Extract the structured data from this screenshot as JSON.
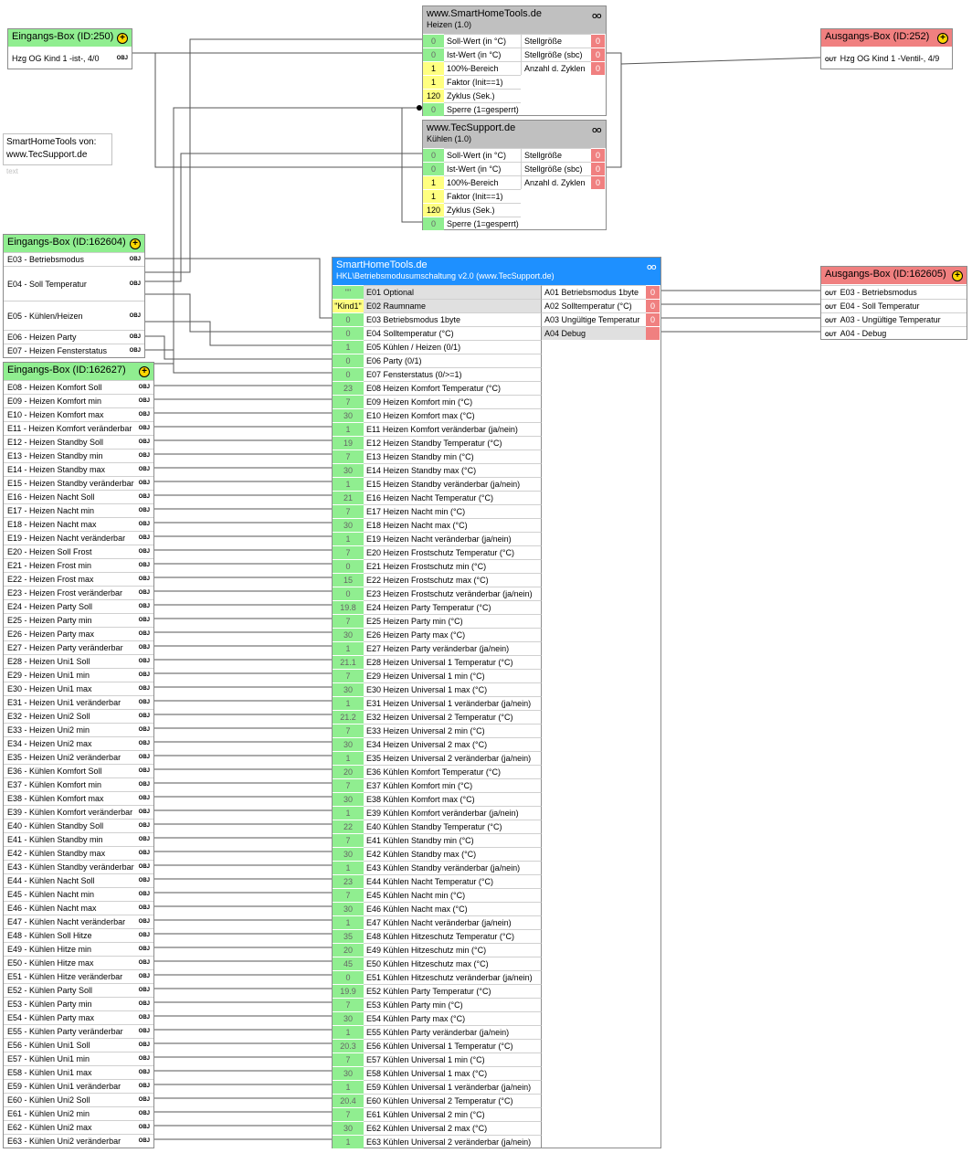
{
  "in250": {
    "title": "Eingangs-Box (ID:250)",
    "rows": [
      "Hzg OG Kind 1 -ist-, 4/0"
    ],
    "tag": "OBJ"
  },
  "out252": {
    "title": "Ausgangs-Box (ID:252)",
    "rows": [
      "Hzg OG Kind 1 -Ventil-, 4/9"
    ],
    "tag": "OUT"
  },
  "heizen": {
    "title": "www.SmartHomeTools.de",
    "subtitle": "Heizen (1.0)",
    "oo": "OO",
    "inputs": [
      {
        "v": "0",
        "l": "Soll-Wert (in °C)"
      },
      {
        "v": "0",
        "l": "Ist-Wert (in °C)"
      },
      {
        "v": "1",
        "l": "100%-Bereich"
      },
      {
        "v": "1",
        "l": "Faktor (Init==1)"
      },
      {
        "v": "120",
        "l": "Zyklus (Sek.)"
      },
      {
        "v": "0",
        "l": "Sperre (1=gesperrt)"
      }
    ],
    "outputs": [
      {
        "l": "Stellgröße",
        "v": "0"
      },
      {
        "l": "Stellgröße (sbc)",
        "v": "0"
      },
      {
        "l": "Anzahl d. Zyklen",
        "v": "0"
      }
    ]
  },
  "kuehlen": {
    "title": "www.TecSupport.de",
    "subtitle": "Kühlen (1.0)",
    "oo": "OO",
    "inputs": [
      {
        "v": "0",
        "l": "Soll-Wert (in °C)"
      },
      {
        "v": "0",
        "l": "Ist-Wert (in °C)"
      },
      {
        "v": "1",
        "l": "100%-Bereich"
      },
      {
        "v": "1",
        "l": "Faktor (Init==1)"
      },
      {
        "v": "120",
        "l": "Zyklus (Sek.)"
      },
      {
        "v": "0",
        "l": "Sperre (1=gesperrt)"
      }
    ],
    "outputs": [
      {
        "l": "Stellgröße",
        "v": "0"
      },
      {
        "l": "Stellgröße (sbc)",
        "v": "0"
      },
      {
        "l": "Anzahl d. Zyklen",
        "v": "0"
      }
    ]
  },
  "note": {
    "line1": "SmartHomeTools von:",
    "line2": "www.TecSupport.de",
    "tag": "text"
  },
  "in162604": {
    "title": "Eingangs-Box (ID:162604)",
    "tag": "OBJ",
    "rows": [
      "E03 - Betriebsmodus",
      "E04 - Soll Temperatur",
      "E05 - Kühlen/Heizen",
      "E06 - Heizen Party",
      "E07 - Heizen Fensterstatus"
    ]
  },
  "in162627": {
    "title": "Eingangs-Box (ID:162627)",
    "tag": "OBJ",
    "rows": [
      "E08 - Heizen Komfort Soll",
      "E09 - Heizen Komfort min",
      "E10 - Heizen Komfort max",
      "E11 - Heizen Komfort veränderbar",
      "E12 - Heizen Standby Soll",
      "E13 - Heizen Standby min",
      "E14 - Heizen Standby max",
      "E15 - Heizen Standby veränderbar",
      "E16 - Heizen Nacht Soll",
      "E17 - Heizen Nacht min",
      "E18 - Heizen Nacht max",
      "E19 - Heizen Nacht veränderbar",
      "E20 - Heizen Soll Frost",
      "E21 - Heizen Frost min",
      "E22 - Heizen Frost max",
      "E23 - Heizen Frost veränderbar",
      "E24 - Heizen Party Soll",
      "E25 - Heizen Party min",
      "E26 - Heizen Party max",
      "E27 - Heizen Party veränderbar",
      "E28 - Heizen Uni1 Soll",
      "E29 - Heizen Uni1 min",
      "E30 - Heizen Uni1 max",
      "E31 - Heizen Uni1 veränderbar",
      "E32 - Heizen Uni2 Soll",
      "E33 - Heizen Uni2 min",
      "E34 - Heizen Uni2 max",
      "E35 - Heizen Uni2 veränderbar",
      "E36 - Kühlen Komfort Soll",
      "E37 - Kühlen Komfort min",
      "E38 - Kühlen Komfort max",
      "E39 - Kühlen Komfort veränderbar",
      "E40 - Kühlen Standby Soll",
      "E41 - Kühlen Standby min",
      "E42 - Kühlen Standby max",
      "E43 - Kühlen Standby veränderbar",
      "E44 - Kühlen Nacht Soll",
      "E45 - Kühlen Nacht min",
      "E46 - Kühlen Nacht max",
      "E47 - Kühlen Nacht veränderbar",
      "E48 - Kühlen Soll Hitze",
      "E49 - Kühlen Hitze min",
      "E50 - Kühlen Hitze max",
      "E51 - Kühlen Hitze veränderbar",
      "E52 - Kühlen Party Soll",
      "E53 - Kühlen Party min",
      "E54 - Kühlen Party max",
      "E55 - Kühlen Party veränderbar",
      "E56 - Kühlen Uni1 Soll",
      "E57 - Kühlen Uni1 min",
      "E58 - Kühlen Uni1 max",
      "E59 - Kühlen Uni1 veränderbar",
      "E60 - Kühlen Uni2 Soll",
      "E61 - Kühlen Uni2 min",
      "E62 - Kühlen Uni2 max",
      "E63 - Kühlen Uni2 veränderbar"
    ]
  },
  "out162605": {
    "title": "Ausgangs-Box (ID:162605)",
    "tag": "OUT",
    "rows": [
      "E03 - Betriebsmodus",
      "E04 - Soll Temperatur",
      "A03 - Ungültige Temperatur",
      "A04 - Debug"
    ]
  },
  "main": {
    "title": "SmartHomeTools.de",
    "subtitle": "HKL\\Betriebsmodusumschaltung v2.0 (www.TecSupport.de)",
    "oo": "OO",
    "outputs": [
      {
        "l": "A01 Betriebsmodus 1byte",
        "v": "0"
      },
      {
        "l": "A02 Solltemperatur (°C)",
        "v": "0"
      },
      {
        "l": "A03 Ungültige Temperatur",
        "v": "0"
      },
      {
        "l": "A04 Debug",
        "v": ""
      }
    ],
    "inputs": [
      {
        "v": "\"\"",
        "l": "E01 Optional",
        "gray": true
      },
      {
        "v": "\"Kind1\"",
        "l": "E02 Raumname",
        "gray": true,
        "y": true
      },
      {
        "v": "0",
        "l": "E03 Betriebsmodus 1byte"
      },
      {
        "v": "0",
        "l": "E04 Solltemperatur (°C)"
      },
      {
        "v": "1",
        "l": "E05 Kühlen / Heizen (0/1)"
      },
      {
        "v": "0",
        "l": "E06 Party (0/1)"
      },
      {
        "v": "0",
        "l": "E07 Fensterstatus (0/>=1)"
      },
      {
        "v": "23",
        "l": "E08 Heizen Komfort Temperatur (°C)"
      },
      {
        "v": "7",
        "l": "E09 Heizen Komfort min (°C)"
      },
      {
        "v": "30",
        "l": "E10 Heizen Komfort max (°C)"
      },
      {
        "v": "1",
        "l": "E11 Heizen Komfort veränderbar (ja/nein)"
      },
      {
        "v": "19",
        "l": "E12 Heizen Standby Temperatur (°C)"
      },
      {
        "v": "7",
        "l": "E13 Heizen Standby min (°C)"
      },
      {
        "v": "30",
        "l": "E14 Heizen Standby max (°C)"
      },
      {
        "v": "1",
        "l": "E15 Heizen Standby veränderbar (ja/nein)"
      },
      {
        "v": "21",
        "l": "E16 Heizen Nacht Temperatur (°C)"
      },
      {
        "v": "7",
        "l": "E17 Heizen Nacht min (°C)"
      },
      {
        "v": "30",
        "l": "E18 Heizen Nacht max (°C)"
      },
      {
        "v": "1",
        "l": "E19 Heizen Nacht veränderbar (ja/nein)"
      },
      {
        "v": "7",
        "l": "E20 Heizen Frostschutz Temperatur (°C)"
      },
      {
        "v": "0",
        "l": "E21 Heizen Frostschutz min (°C)"
      },
      {
        "v": "15",
        "l": "E22 Heizen Frostschutz max (°C)"
      },
      {
        "v": "0",
        "l": "E23 Heizen Frostschutz veränderbar (ja/nein)"
      },
      {
        "v": "19.8",
        "l": "E24 Heizen Party Temperatur (°C)"
      },
      {
        "v": "7",
        "l": "E25 Heizen Party min (°C)"
      },
      {
        "v": "30",
        "l": "E26 Heizen Party max (°C)"
      },
      {
        "v": "1",
        "l": "E27 Heizen Party veränderbar (ja/nein)"
      },
      {
        "v": "21.1",
        "l": "E28 Heizen Universal 1 Temperatur (°C)"
      },
      {
        "v": "7",
        "l": "E29 Heizen Universal 1 min (°C)"
      },
      {
        "v": "30",
        "l": "E30 Heizen Universal 1 max (°C)"
      },
      {
        "v": "1",
        "l": "E31 Heizen Universal 1 veränderbar (ja/nein)"
      },
      {
        "v": "21.2",
        "l": "E32 Heizen Universal 2 Temperatur (°C)"
      },
      {
        "v": "7",
        "l": "E33 Heizen Universal 2 min (°C)"
      },
      {
        "v": "30",
        "l": "E34 Heizen Universal 2 max (°C)"
      },
      {
        "v": "1",
        "l": "E35 Heizen Universal 2 veränderbar (ja/nein)"
      },
      {
        "v": "20",
        "l": "E36 Kühlen Komfort Temperatur (°C)"
      },
      {
        "v": "7",
        "l": "E37 Kühlen Komfort min (°C)"
      },
      {
        "v": "30",
        "l": "E38 Kühlen Komfort max (°C)"
      },
      {
        "v": "1",
        "l": "E39 Kühlen Komfort veränderbar (ja/nein)"
      },
      {
        "v": "22",
        "l": "E40 Kühlen Standby Temperatur (°C)"
      },
      {
        "v": "7",
        "l": "E41 Kühlen Standby min (°C)"
      },
      {
        "v": "30",
        "l": "E42 Kühlen Standby max (°C)"
      },
      {
        "v": "1",
        "l": "E43 Kühlen Standby veränderbar (ja/nein)"
      },
      {
        "v": "23",
        "l": "E44 Kühlen Nacht Temperatur (°C)"
      },
      {
        "v": "7",
        "l": "E45 Kühlen Nacht min (°C)"
      },
      {
        "v": "30",
        "l": "E46 Kühlen Nacht max (°C)"
      },
      {
        "v": "1",
        "l": "E47 Kühlen Nacht veränderbar (ja/nein)"
      },
      {
        "v": "35",
        "l": "E48 Kühlen Hitzeschutz Temperatur (°C)"
      },
      {
        "v": "20",
        "l": "E49 Kühlen Hitzeschutz min (°C)"
      },
      {
        "v": "45",
        "l": "E50 Kühlen Hitzeschutz max (°C)"
      },
      {
        "v": "0",
        "l": "E51 Kühlen Hitzeschutz veränderbar (ja/nein)"
      },
      {
        "v": "19.9",
        "l": "E52 Kühlen Party Temperatur (°C)"
      },
      {
        "v": "7",
        "l": "E53 Kühlen Party min (°C)"
      },
      {
        "v": "30",
        "l": "E54 Kühlen Party max (°C)"
      },
      {
        "v": "1",
        "l": "E55 Kühlen Party veränderbar (ja/nein)"
      },
      {
        "v": "20.3",
        "l": "E56 Kühlen Universal 1 Temperatur (°C)"
      },
      {
        "v": "7",
        "l": "E57 Kühlen Universal 1 min (°C)"
      },
      {
        "v": "30",
        "l": "E58 Kühlen Universal 1 max (°C)"
      },
      {
        "v": "1",
        "l": "E59 Kühlen Universal 1 veränderbar (ja/nein)"
      },
      {
        "v": "20.4",
        "l": "E60 Kühlen Universal 2 Temperatur (°C)"
      },
      {
        "v": "7",
        "l": "E61 Kühlen Universal 2 min (°C)"
      },
      {
        "v": "30",
        "l": "E62 Kühlen Universal 2 max (°C)"
      },
      {
        "v": "1",
        "l": "E63 Kühlen Universal 2 veränderbar (ja/nein)"
      }
    ]
  }
}
